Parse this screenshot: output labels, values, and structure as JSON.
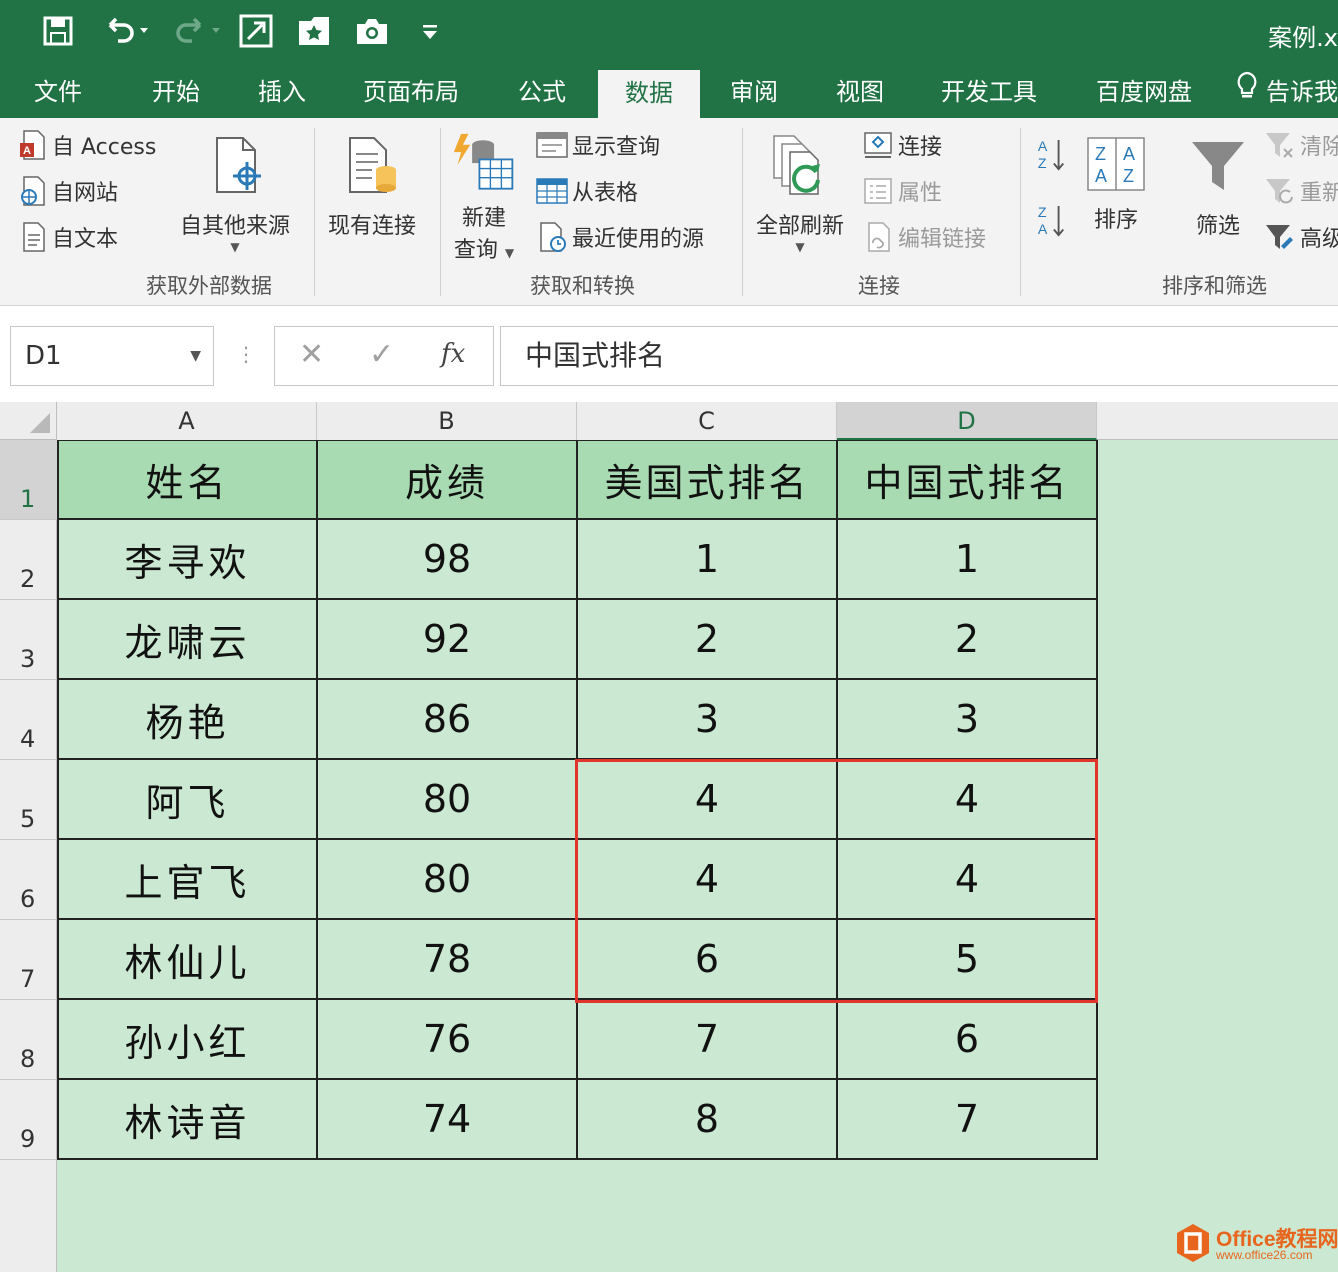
{
  "window": {
    "title": "案例.x"
  },
  "colors": {
    "brand": "#217346",
    "header_fill": "#a9dbb3",
    "cell_fill": "#cbe9d2",
    "highlight": "#e0342d",
    "watermark": "#e8651d"
  },
  "qat": {
    "save_icon": "save-icon",
    "undo_icon": "undo-icon",
    "redo_icon": "redo-icon",
    "icons": [
      "save-icon",
      "undo-icon",
      "redo-icon",
      "expand-icon",
      "star-folder-icon",
      "camera-icon",
      "customize-icon"
    ]
  },
  "tabs": [
    {
      "label": "文件"
    },
    {
      "label": "开始"
    },
    {
      "label": "插入"
    },
    {
      "label": "页面布局"
    },
    {
      "label": "公式"
    },
    {
      "label": "数据",
      "active": true
    },
    {
      "label": "审阅"
    },
    {
      "label": "视图"
    },
    {
      "label": "开发工具"
    },
    {
      "label": "百度网盘"
    },
    {
      "label": "告诉我"
    }
  ],
  "ribbon": {
    "get_external": {
      "label": "获取外部数据",
      "from_access": "自 Access",
      "from_web": "自网站",
      "from_text": "自文本",
      "from_other": "自其他来源",
      "existing": "现有连接"
    },
    "get_transform": {
      "label": "获取和转换",
      "new_query_1": "新建",
      "new_query_2": "查询",
      "show_queries": "显示查询",
      "from_table": "从表格",
      "recent_sources": "最近使用的源"
    },
    "connections": {
      "label": "连接",
      "refresh_all": "全部刷新",
      "connections": "连接",
      "properties": "属性",
      "edit_links": "编辑链接"
    },
    "sort_filter": {
      "label": "排序和筛选",
      "sort": "排序",
      "filter": "筛选",
      "clear": "清除",
      "reapply": "重新",
      "advanced": "高级"
    }
  },
  "formula_bar": {
    "name_box": "D1",
    "cancel": "✕",
    "enter": "✓",
    "fx": "fx",
    "value": "中国式排名"
  },
  "sheet": {
    "columns": [
      "A",
      "B",
      "C",
      "D"
    ],
    "rows": [
      "1",
      "2",
      "3",
      "4",
      "5",
      "6",
      "7",
      "8",
      "9"
    ],
    "selected_column": "D",
    "selected_row": "1",
    "header": [
      "姓名",
      "成绩",
      "美国式排名",
      "中国式排名"
    ],
    "data": [
      [
        "李寻欢",
        "98",
        "1",
        "1"
      ],
      [
        "龙啸云",
        "92",
        "2",
        "2"
      ],
      [
        "杨艳",
        "86",
        "3",
        "3"
      ],
      [
        "阿飞",
        "80",
        "4",
        "4"
      ],
      [
        "上官飞",
        "80",
        "4",
        "4"
      ],
      [
        "林仙儿",
        "78",
        "6",
        "5"
      ],
      [
        "孙小红",
        "76",
        "7",
        "6"
      ],
      [
        "林诗音",
        "74",
        "8",
        "7"
      ]
    ]
  },
  "watermark": {
    "brand": "Office教程网",
    "url": "www.office26.com"
  }
}
